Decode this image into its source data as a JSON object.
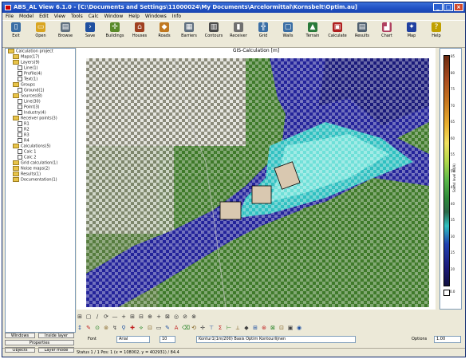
{
  "window": {
    "title": "ABS_AL View 6.1.0 - [C:\\Documents and Settings\\11000024\\My Documents\\Arcelormittal\\Kornsbelt\\Optim.au]",
    "controls": {
      "minimize": "_",
      "maximize": "□",
      "close": "×"
    }
  },
  "menu": [
    "File",
    "Model",
    "Edit",
    "View",
    "Tools",
    "Calc",
    "Window",
    "Help",
    "Windows",
    "Info"
  ],
  "toolbar": [
    {
      "label": "Exit",
      "icon": "document-icon",
      "color": "#3a6ea5",
      "glyph": "▯"
    },
    {
      "label": "Open",
      "icon": "folder-icon",
      "color": "#d9a520",
      "glyph": "▭"
    },
    {
      "label": "Browse",
      "icon": "print-icon",
      "color": "#607080",
      "glyph": "▤"
    },
    {
      "label": "Save",
      "icon": "arrow-icon",
      "color": "#2050a0",
      "glyph": "›"
    },
    {
      "label": "Buildings",
      "icon": "windmill-icon",
      "color": "#5a8a2a",
      "glyph": "✢"
    },
    {
      "label": "Houses",
      "icon": "house-icon",
      "color": "#a04020",
      "glyph": "⌂"
    },
    {
      "label": "Roads",
      "icon": "box-icon",
      "color": "#c07820",
      "glyph": "◆"
    },
    {
      "label": "Barriers",
      "icon": "grid-icon",
      "color": "#607080",
      "glyph": "▦"
    },
    {
      "label": "Contours",
      "icon": "factory-icon",
      "color": "#4a4a4a",
      "glyph": "▥"
    },
    {
      "label": "Receiver",
      "icon": "tower-icon",
      "color": "#707070",
      "glyph": "▮"
    },
    {
      "label": "Grid",
      "icon": "table-icon",
      "color": "#3a6ea5",
      "glyph": "╬"
    },
    {
      "label": "Walls",
      "icon": "frame-icon",
      "color": "#3a6ea5",
      "glyph": "▢"
    },
    {
      "label": "Terrain",
      "icon": "terrain-icon",
      "color": "#2a7a3a",
      "glyph": "▲"
    },
    {
      "label": "Calculate",
      "icon": "calc-icon",
      "color": "#b02020",
      "glyph": "▣"
    },
    {
      "label": "Results",
      "icon": "results-icon",
      "color": "#506070",
      "glyph": "▤"
    },
    {
      "label": "Chart",
      "icon": "chart-icon",
      "color": "#b04060",
      "glyph": "▟"
    },
    {
      "label": "Map",
      "icon": "compass-icon",
      "color": "#2040a0",
      "glyph": "✦"
    },
    {
      "label": "Help",
      "icon": "help-icon",
      "color": "#c0a000",
      "glyph": "?"
    }
  ],
  "tree": [
    "Calculation project",
    "  Maps(17)",
    "  Layers(9)",
    "    Line(1)",
    "    Profile(4)",
    "    Text(1)",
    "  Groups",
    "    Ground(1)",
    "  Sources(8)",
    "    Line(30)",
    "    Point(3)",
    "    Industry(4)",
    "  Receiver points(3)",
    "    R1",
    "    R2",
    "    R3",
    "    R4",
    "  Calculations(5)",
    "    Calc 1",
    "    Calc 2",
    "  Grid calculation(1)",
    "  Noise maps(2)",
    "  Results(1)",
    "  Documentation(1)"
  ],
  "sidebar_buttons": {
    "new": "Windows",
    "edit": "Inside layer",
    "prop": "Properties",
    "main": "Objects",
    "extra": "Layer mode"
  },
  "map": {
    "title": "GIS-Calculation [m]",
    "legend_ticks": [
      "85",
      "80",
      "75",
      "70",
      "65",
      "60",
      "55",
      "50",
      "45",
      "40",
      "35",
      "30",
      "25",
      "20"
    ],
    "legend_label": "Sound level dB(A)",
    "legend_box": "0.0"
  },
  "draw_tools": [
    "⊞",
    "▢",
    "∕",
    "⟳",
    "—",
    "+",
    "⊞",
    "⊟",
    "⊕",
    "+",
    "⊠",
    "◎",
    "⊘",
    "⊗"
  ],
  "anno_tools": [
    "↕",
    "✎",
    "⊙",
    "⊚",
    "↯",
    "⚲",
    "✚",
    "⟡",
    "⊡",
    "▭",
    "✎",
    "A",
    "⌫",
    "⟲",
    "✛",
    "⊤",
    "Σ",
    "⊢",
    "⟂",
    "◆",
    "⊞",
    "⊛",
    "⊠",
    "⊡",
    "▣",
    "◉"
  ],
  "format_row": {
    "font_label": "Font",
    "font_value": "Arial",
    "size_value": "10",
    "desc": "Kontur1(1m/200) Basis Optim Kontourlijnen",
    "options_label": "Options",
    "options_value": "1.00"
  },
  "status": "Status 1 / 1 Pos: 1 (x = 108002, y = 402931) / 84.4"
}
